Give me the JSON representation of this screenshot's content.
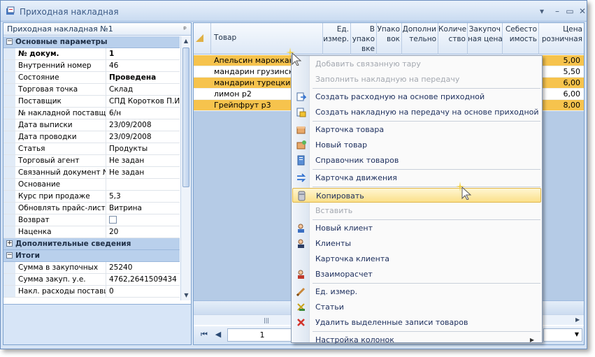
{
  "window": {
    "title": "Приходная накладная"
  },
  "left_panel": {
    "header": "Приходная накладная №1",
    "sections": [
      {
        "title": "Основные параметры",
        "expanded": true,
        "rows": [
          {
            "key": "№ докум.",
            "value": "1",
            "bold": true
          },
          {
            "key": "Внутренний номер",
            "value": "46"
          },
          {
            "key": "Состояние",
            "value": "Проведена",
            "bold_value": true
          },
          {
            "key": "Торговая точка",
            "value": "Склад"
          },
          {
            "key": "Поставщик",
            "value": "СПД Коротков П.И."
          },
          {
            "key": "№ накладной поставщик",
            "value": "6/н"
          },
          {
            "key": "Дата выписки",
            "value": "23/09/2008"
          },
          {
            "key": "Дата проводки",
            "value": "23/09/2008"
          },
          {
            "key": "Статья",
            "value": "Продукты"
          },
          {
            "key": "Торговый агент",
            "value": "Не задан"
          },
          {
            "key": "Связанный документ №",
            "value": "Не задан"
          },
          {
            "key": "Основание",
            "value": ""
          },
          {
            "key": "Курс при продаже",
            "value": "5,3"
          },
          {
            "key": "Обновлять прайс-лист",
            "value": "Витрина"
          },
          {
            "key": "Возврат",
            "value": "",
            "checkbox": true
          },
          {
            "key": "Наценка",
            "value": "20"
          }
        ]
      },
      {
        "title": "Дополнительные сведения",
        "expanded": false,
        "rows": []
      },
      {
        "title": "Итоги",
        "expanded": true,
        "rows": [
          {
            "key": "Сумма в закупочных",
            "value": "25240"
          },
          {
            "key": "Сумма закуп. у.е.",
            "value": "4762,2641509434"
          },
          {
            "key": "Накл. расходы поставщи",
            "value": "0"
          }
        ]
      }
    ]
  },
  "table": {
    "columns": {
      "tovar": "Товар",
      "ed": "Ед.\nизмер.",
      "v_upak": "В\nупако\nвке",
      "upak": "Упако\nвок",
      "dop": "Дополни\nтельно",
      "kol": "Количе\nство",
      "zak": "Закупоч\nная цена",
      "seb": "Себесто\nимость",
      "price": "Цена\nрозничная"
    },
    "rows": [
      {
        "name": "Апельсин марокканс",
        "price": "5,00",
        "color": "#f6c34d"
      },
      {
        "name": "мандарин грузинский",
        "price": "5,50",
        "color": "#ffffff"
      },
      {
        "name": "мандарин турецкий",
        "price": "6,00",
        "color": "#f6c34d"
      },
      {
        "name": "лимон р2",
        "price": "6,00",
        "color": "#ffffff"
      },
      {
        "name": "Грейпфрут р3",
        "price": "8,00",
        "color": "#f6c34d"
      }
    ],
    "page": "1"
  },
  "context_menu": {
    "items": [
      {
        "label": "Добавить связанную тару",
        "disabled": true,
        "icon": "none"
      },
      {
        "label": "Заполнить накладную на передачу",
        "disabled": true,
        "icon": "none"
      },
      {
        "sep": true
      },
      {
        "label": "Создать расходную на основе приходной",
        "icon": "create-doc-icon"
      },
      {
        "label": "Создать накладную на передачу на основе приходной",
        "icon": "transfer-doc-icon"
      },
      {
        "sep": true
      },
      {
        "label": "Карточка товара",
        "icon": "product-card-icon"
      },
      {
        "label": "Новый товар",
        "icon": "new-product-icon"
      },
      {
        "label": "Справочник товаров",
        "icon": "catalog-icon"
      },
      {
        "sep": true
      },
      {
        "label": "Карточка движения",
        "icon": "movement-icon"
      },
      {
        "sep": true
      },
      {
        "label": "Копировать",
        "icon": "copy-icon",
        "highlighted": true
      },
      {
        "label": "Вставить",
        "disabled": true,
        "icon": "none"
      },
      {
        "sep": true
      },
      {
        "label": "Новый клиент",
        "icon": "new-client-icon"
      },
      {
        "label": "Клиенты",
        "icon": "clients-icon"
      },
      {
        "label": "Карточка клиента",
        "icon": "none"
      },
      {
        "label": "Взаиморасчет",
        "icon": "settlement-icon"
      },
      {
        "sep": true
      },
      {
        "label": "Ед. измер.",
        "icon": "units-icon"
      },
      {
        "label": "Статьи",
        "icon": "articles-icon"
      },
      {
        "label": "Удалить выделенные записи товаров",
        "icon": "delete-icon"
      },
      {
        "sep": true
      },
      {
        "label": "Настройка колонок",
        "icon": "none",
        "submenu": true
      }
    ]
  }
}
